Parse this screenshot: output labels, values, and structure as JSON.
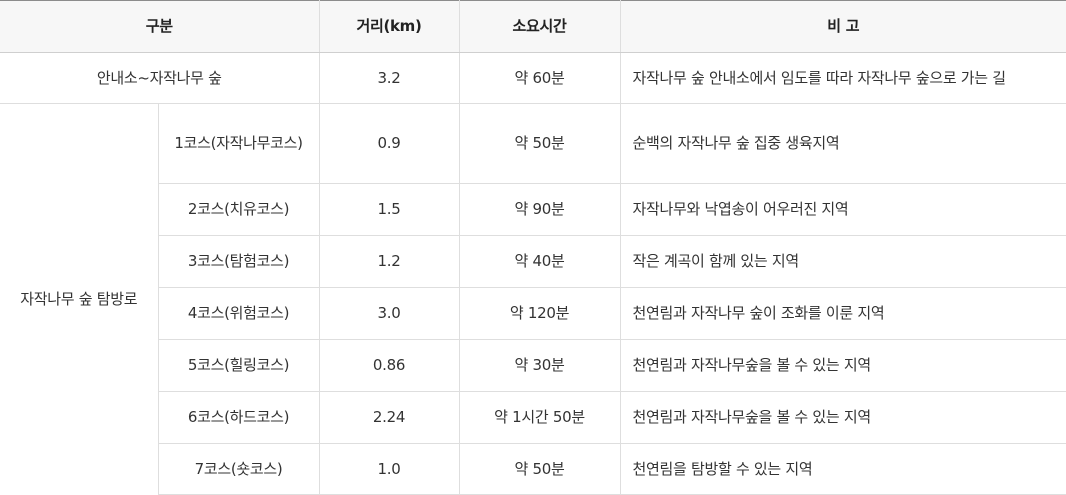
{
  "header": {
    "category": "구분",
    "distance": "거리(km)",
    "duration": "소요시간",
    "note": "비 고"
  },
  "intro_row": {
    "label": "안내소~자작나무 숲",
    "distance": "3.2",
    "duration": "약 60분",
    "note": "자작나무 숲 안내소에서 임도를 따라 자작나무 숲으로 가는 길"
  },
  "trail_group": {
    "label": "자작나무 숲 탐방로",
    "courses": [
      {
        "name": "1코스(자작나무코스)",
        "distance": "0.9",
        "duration": "약 50분",
        "note": "순백의 자작나무 숲 집중 생육지역"
      },
      {
        "name": "2코스(치유코스)",
        "distance": "1.5",
        "duration": "약 90분",
        "note": "자작나무와 낙엽송이 어우러진 지역"
      },
      {
        "name": "3코스(탐험코스)",
        "distance": "1.2",
        "duration": "약 40분",
        "note": "작은 계곡이 함께 있는 지역"
      },
      {
        "name": "4코스(위험코스)",
        "distance": "3.0",
        "duration": "약 120분",
        "note": "천연림과 자작나무 숲이 조화를 이룬 지역"
      },
      {
        "name": "5코스(힐링코스)",
        "distance": "0.86",
        "duration": "약 30분",
        "note": "천연림과 자작나무숲을 볼 수 있는 지역"
      },
      {
        "name": "6코스(하드코스)",
        "distance": "2.24",
        "duration": "약 1시간 50분",
        "note": "천연림과 자작나무숲을 볼 수 있는 지역"
      },
      {
        "name": "7코스(숏코스)",
        "distance": "1.0",
        "duration": "약 50분",
        "note": "천연림을 탐방할 수 있는 지역"
      }
    ]
  }
}
